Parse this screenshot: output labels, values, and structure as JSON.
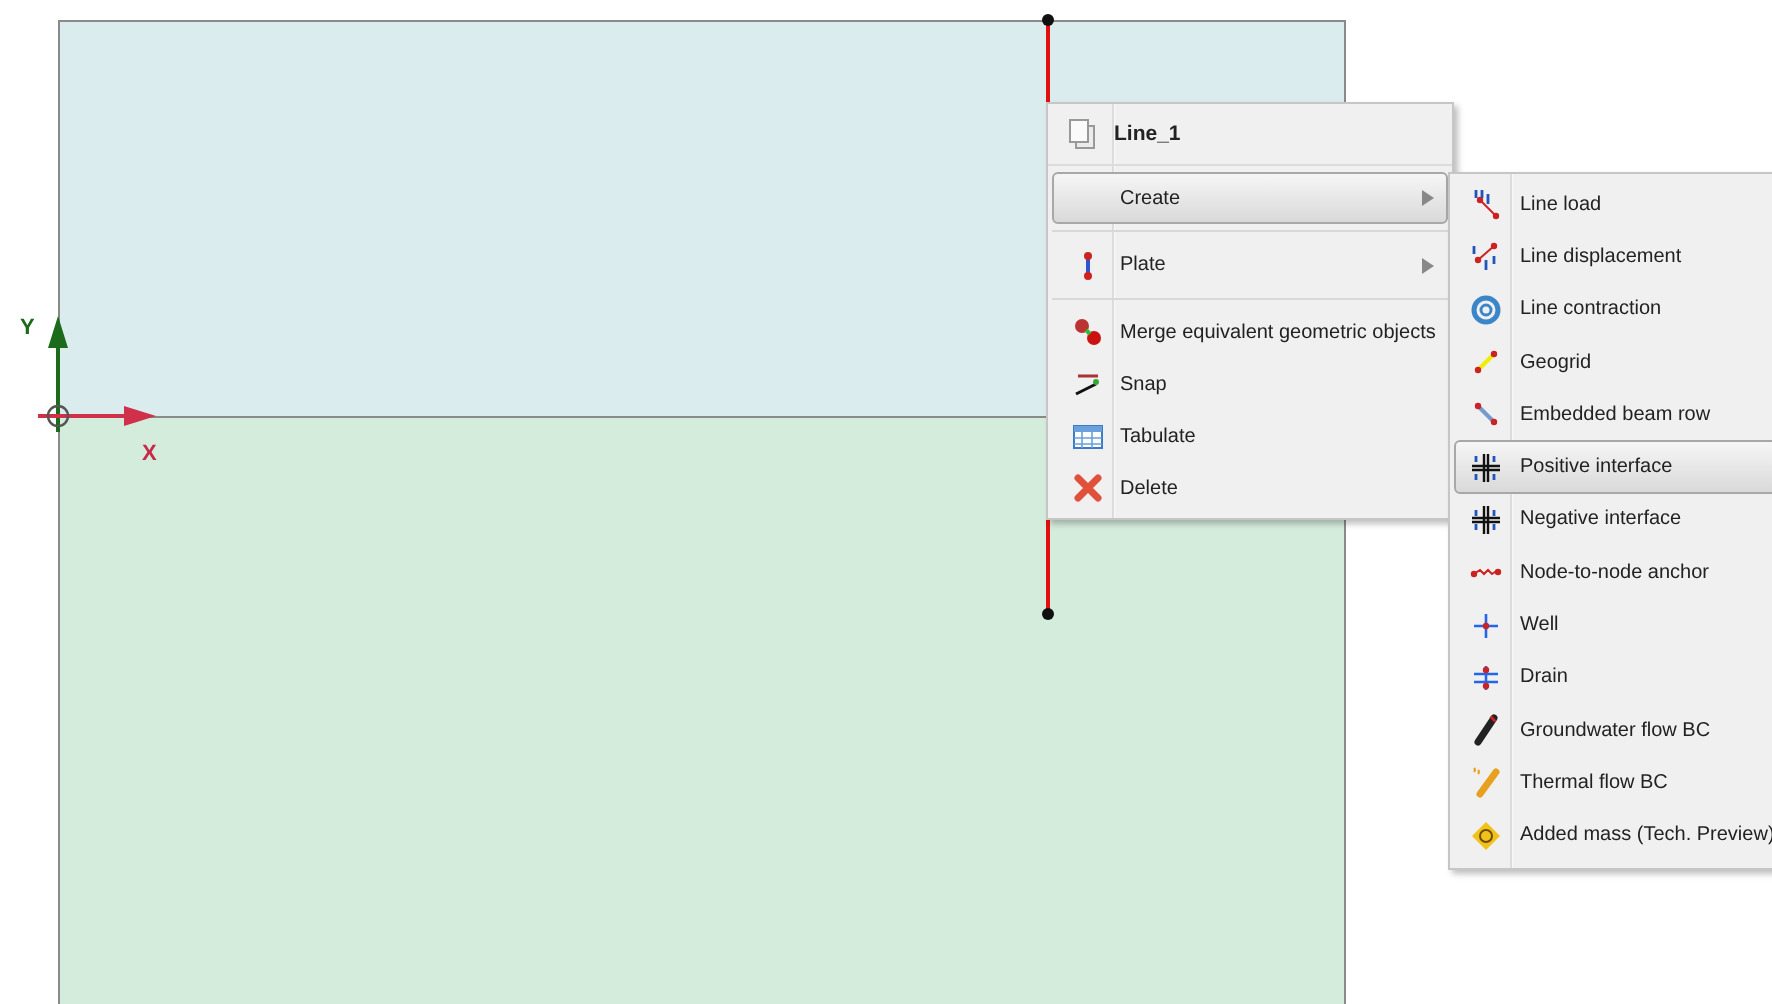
{
  "canvas": {
    "y_axis_label": "Y",
    "x_axis_label": "X"
  },
  "context_menu": {
    "title": "Line_1",
    "items": [
      {
        "kind": "submenu",
        "label": "Create",
        "selected": true
      },
      {
        "kind": "submenu",
        "label": "Plate",
        "selected": false
      },
      {
        "kind": "action",
        "label": "Merge equivalent geometric objects",
        "selected": false
      },
      {
        "kind": "action",
        "label": "Snap",
        "selected": false
      },
      {
        "kind": "action",
        "label": "Tabulate",
        "selected": false
      },
      {
        "kind": "action",
        "label": "Delete",
        "selected": false
      }
    ]
  },
  "create_submenu": {
    "items": [
      {
        "label": "Line load",
        "selected": false
      },
      {
        "label": "Line displacement",
        "selected": false
      },
      {
        "label": "Line contraction",
        "selected": false
      },
      {
        "label": "Geogrid",
        "selected": false
      },
      {
        "label": "Embedded beam row",
        "selected": false
      },
      {
        "label": "Positive interface",
        "selected": true
      },
      {
        "label": "Negative interface",
        "selected": false
      },
      {
        "label": "Node-to-node anchor",
        "selected": false
      },
      {
        "label": "Well",
        "selected": false
      },
      {
        "label": "Drain",
        "selected": false
      },
      {
        "label": "Groundwater flow BC",
        "selected": false
      },
      {
        "label": "Thermal flow BC",
        "selected": false
      },
      {
        "label": "Added mass (Tech. Preview)",
        "selected": false
      }
    ]
  }
}
